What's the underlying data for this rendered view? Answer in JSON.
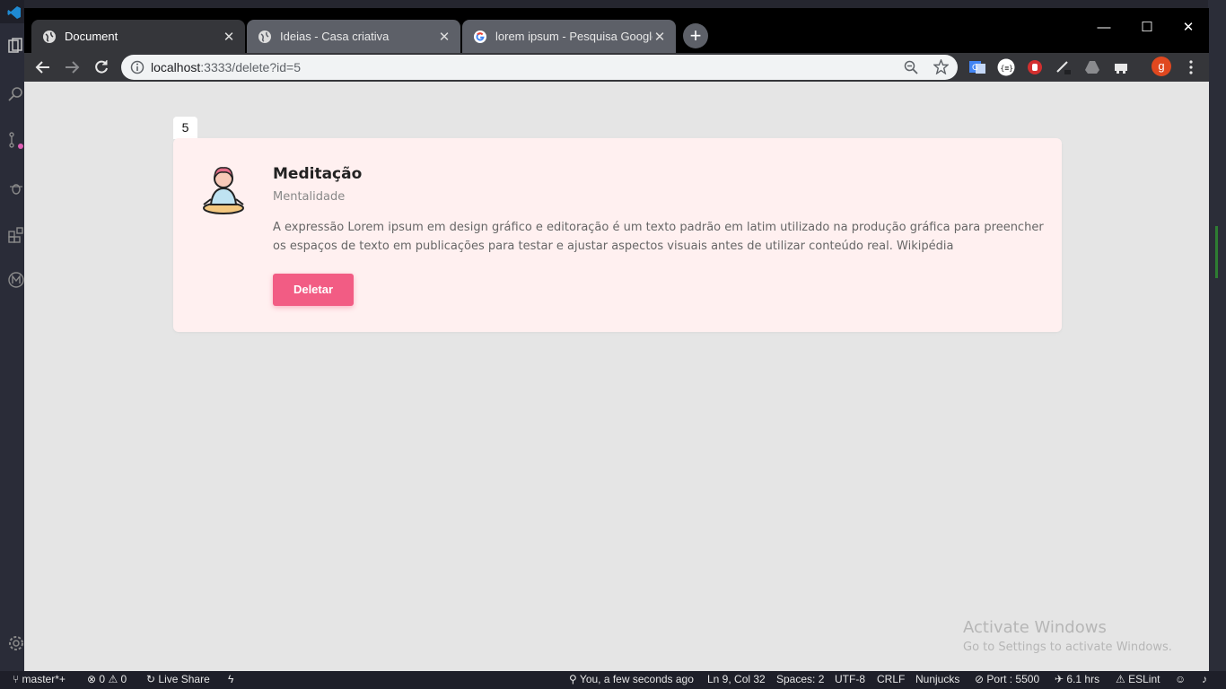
{
  "browser": {
    "tabs": [
      {
        "title": "Document",
        "active": true
      },
      {
        "title": "Ideias - Casa criativa",
        "active": false
      },
      {
        "title": "lorem ipsum - Pesquisa Google",
        "active": false
      }
    ],
    "new_tab": "+",
    "url_host": "localhost",
    "url_rest": ":3333/delete?id=5",
    "avatar_letter": "g",
    "window_controls": {
      "minimize": "—",
      "maximize": "☐",
      "close": "✕"
    }
  },
  "page": {
    "id_badge": "5",
    "idea": {
      "title": "Meditação",
      "category": "Mentalidade",
      "description": "A expressão Lorem ipsum em design gráfico e editoração é um texto padrão em latim utilizado na produção gráfica para preencher os espaços de texto em publicações para testar e ajustar aspectos visuais antes de utilizar conteúdo real. Wikipédia",
      "delete_label": "Deletar"
    }
  },
  "watermark": {
    "line1": "Activate Windows",
    "line2": "Go to Settings to activate Windows."
  },
  "statusbar": {
    "branch": "master*+",
    "errors": "0",
    "warnings": "0",
    "live_share": "Live Share",
    "blame": "You, a few seconds ago",
    "position": "Ln 9, Col 32",
    "spaces": "Spaces: 2",
    "encoding": "UTF-8",
    "eol": "CRLF",
    "language": "Nunjucks",
    "port": "Port : 5500",
    "time": "6.1 hrs",
    "eslint": "ESLint"
  },
  "colors": {
    "accent_pink": "#f25c84",
    "card_bg": "#fff0f0",
    "page_bg": "#e5e5e5"
  }
}
